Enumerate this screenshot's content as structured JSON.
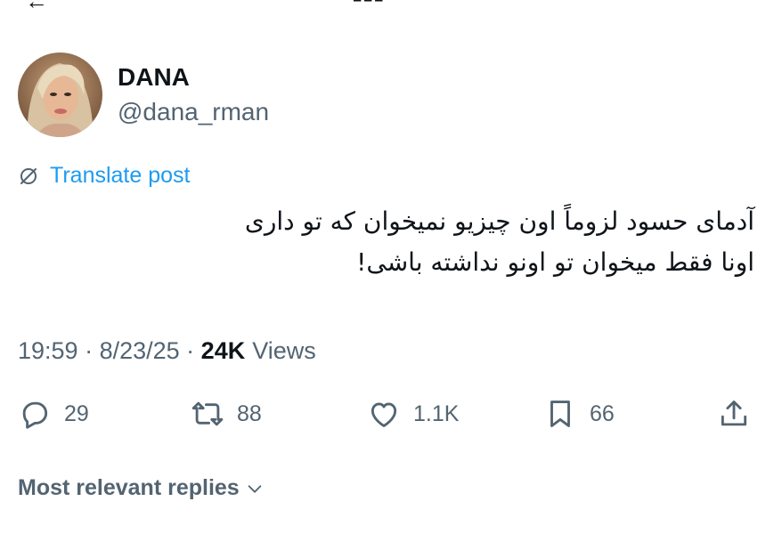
{
  "user": {
    "display_name": "DANA",
    "handle": "@dana_rman"
  },
  "translate_label": "Translate post",
  "tweet": {
    "lines": [
      "آدمای حسود لزوماً اون چیزیو نمیخوان که تو داری",
      "اونا فقط میخوان تو اونو نداشته باشی!"
    ]
  },
  "meta": {
    "time": "19:59",
    "date": "8/23/25",
    "views_count": "24K",
    "views_label": "Views"
  },
  "actions": {
    "replies": "29",
    "reposts": "88",
    "likes": "1.1K",
    "bookmarks": "66"
  },
  "replies_sort_label": "Most relevant replies",
  "colors": {
    "text": "#0f1419",
    "secondary": "#536471",
    "accent": "#1d9bf0"
  },
  "icons": [
    "back-icon",
    "translate-icon",
    "reply-icon",
    "repost-icon",
    "like-icon",
    "bookmark-icon",
    "share-icon",
    "chevron-down-icon"
  ]
}
